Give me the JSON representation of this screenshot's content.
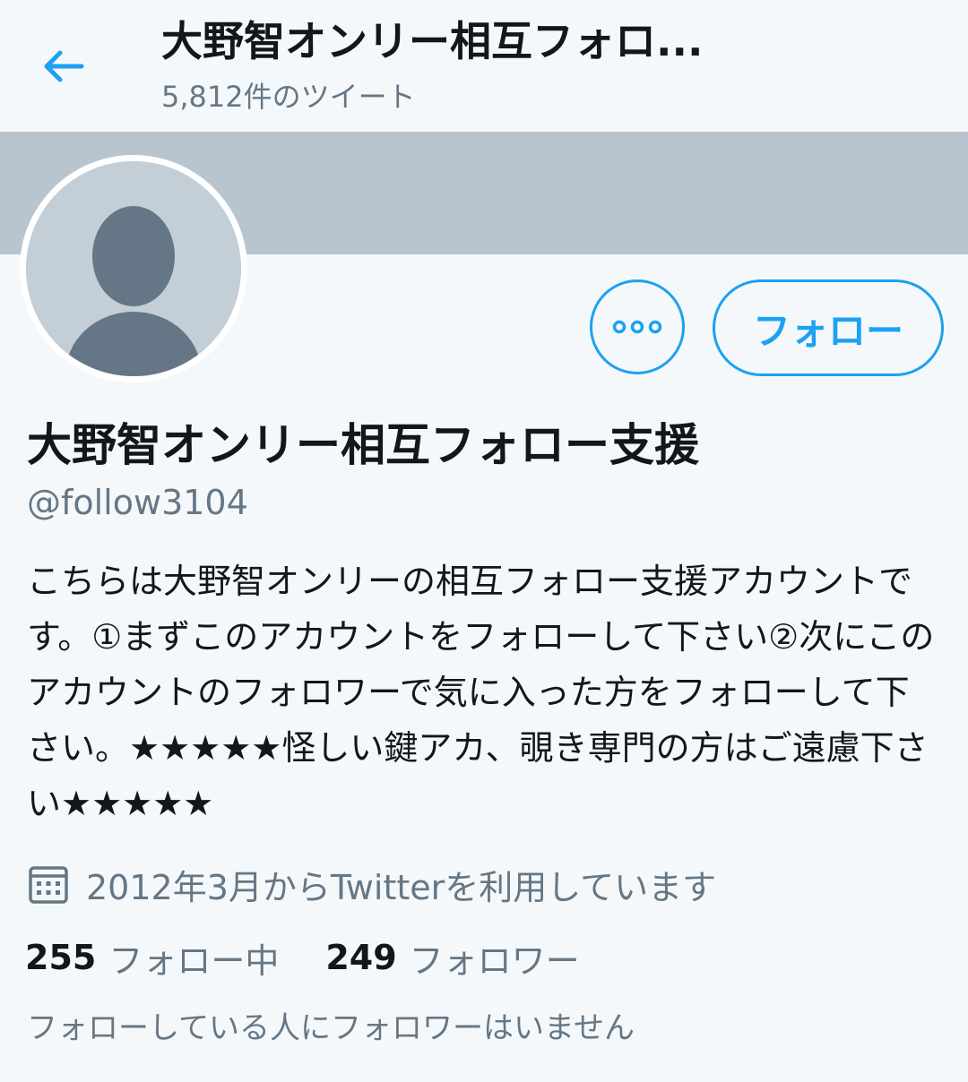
{
  "header": {
    "title": "大野智オンリー相互フォロ...",
    "subtitle": "5,812件のツイート",
    "back_icon": "arrow-left-icon"
  },
  "colors": {
    "accent": "#1da1f2",
    "banner": "#b8c5cf",
    "muted_text": "#657786",
    "text": "#14171a",
    "background": "#f5f8fa"
  },
  "profile": {
    "display_name": "大野智オンリー相互フォロー支援",
    "handle": "@follow3104",
    "bio": "こちらは大野智オンリーの相互フォロー支援アカウントです。①まずこのアカウントをフォローして下さい②次にこのアカウントのフォロワーで気に入った方をフォローして下さい。★★★★★怪しい鍵アカ、覗き専門の方はご遠慮下さい★★★★★",
    "joined": "2012年3月からTwitterを利用しています",
    "joined_icon": "calendar-icon"
  },
  "actions": {
    "more_icon": "more-options-icon",
    "follow_label": "フォロー"
  },
  "stats": {
    "following_count": "255",
    "following_label": "フォロー中",
    "followers_count": "249",
    "followers_label": "フォロワー"
  },
  "note": "フォローしている人にフォロワーはいません"
}
